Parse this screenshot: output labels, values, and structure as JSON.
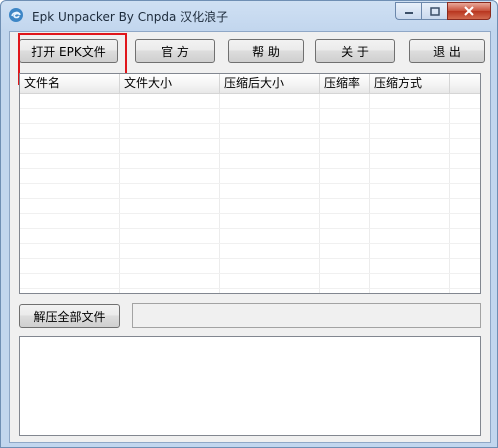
{
  "window": {
    "title": "Epk Unpacker By Cnpda 汉化浪子",
    "icon": "app-swirl-icon"
  },
  "toolbar": {
    "open_label": "打开 EPK文件",
    "official_label": "官 方",
    "help_label": "帮 助",
    "about_label": "关 于",
    "exit_label": "退 出"
  },
  "file_list": {
    "columns": [
      "文件名",
      "文件大小",
      "压缩后大小",
      "压缩率",
      "压缩方式"
    ],
    "rows": []
  },
  "actions": {
    "extract_all_label": "解压全部文件"
  },
  "status": {
    "path_value": ""
  },
  "log": {
    "text": ""
  },
  "colors": {
    "highlight": "#e0161b",
    "frame": "#c2d6ee",
    "close_button": "#c74f39"
  }
}
